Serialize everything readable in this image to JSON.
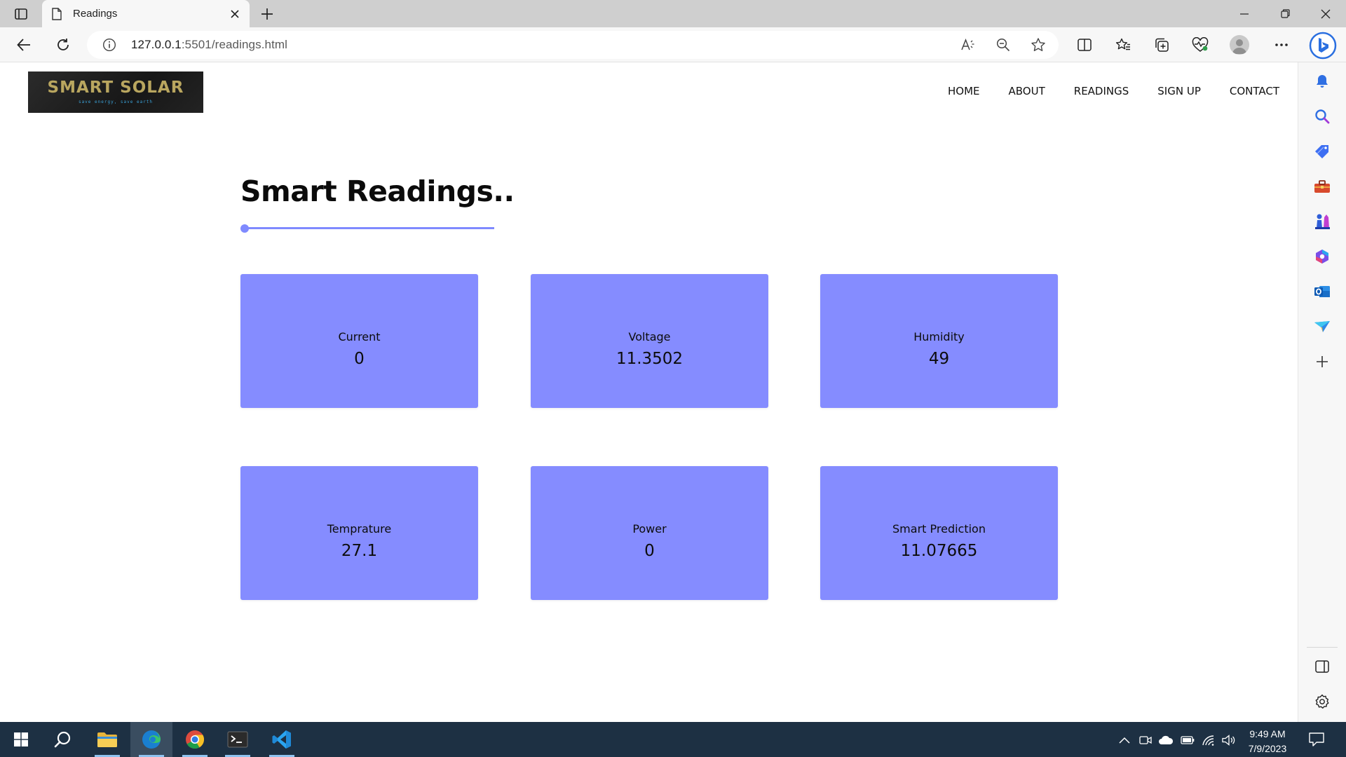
{
  "browser": {
    "tab": {
      "title": "Readings"
    },
    "url": {
      "host": "127.0.0.1",
      "path": ":5501/readings.html"
    }
  },
  "site": {
    "logo": {
      "title": "SMART SOLAR",
      "tagline": "save energy, save earth"
    },
    "nav": [
      {
        "label": "HOME"
      },
      {
        "label": "ABOUT"
      },
      {
        "label": "READINGS"
      },
      {
        "label": "SIGN UP"
      },
      {
        "label": "CONTACT"
      }
    ],
    "heading": "Smart Readings..",
    "cards": [
      {
        "label": "Current",
        "value": "0"
      },
      {
        "label": "Voltage",
        "value": "11.3502"
      },
      {
        "label": "Humidity",
        "value": "49"
      },
      {
        "label": "Temprature",
        "value": "27.1"
      },
      {
        "label": "Power",
        "value": "0"
      },
      {
        "label": "Smart Prediction",
        "value": "11.07665"
      }
    ]
  },
  "taskbar": {
    "time": "9:49 AM",
    "date": "7/9/2023"
  },
  "colors": {
    "accent": "#858cff",
    "taskbar": "#1d3043",
    "logo_text": "#b9a65f"
  }
}
